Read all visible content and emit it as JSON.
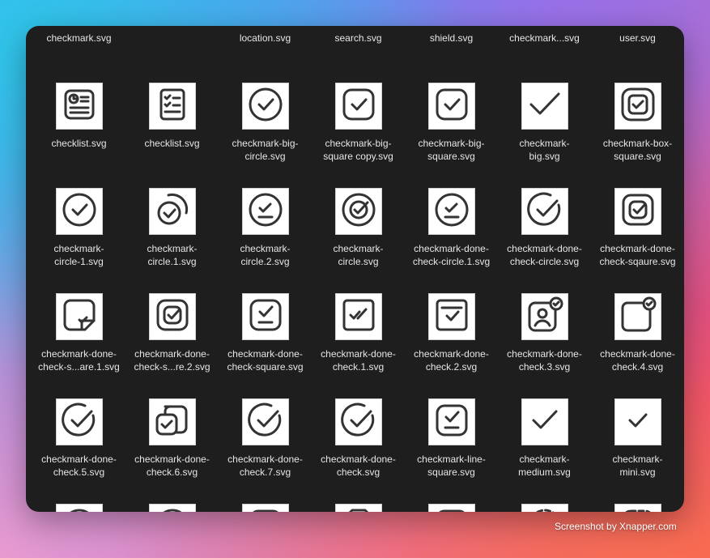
{
  "window": {
    "files": [
      {
        "name": "checkmark.svg",
        "icon": "checkmark-icon"
      },
      {
        "name": "",
        "icon": "blank"
      },
      {
        "name": "location.svg",
        "icon": "location-icon"
      },
      {
        "name": "search.svg",
        "icon": "search-icon"
      },
      {
        "name": "shield.svg",
        "icon": "shield-icon"
      },
      {
        "name": "checkmark...svg",
        "icon": "checkmark-icon"
      },
      {
        "name": "user.svg",
        "icon": "user-icon"
      },
      {
        "name": "checklist.svg",
        "icon": "checklist-clock-icon"
      },
      {
        "name": "checklist.svg",
        "icon": "checklist-document-icon"
      },
      {
        "name": "checkmark-big-\ncircle.svg",
        "icon": "checkmark-big-circle-icon"
      },
      {
        "name": "checkmark-big-\nsquare copy.svg",
        "icon": "checkmark-big-square-icon"
      },
      {
        "name": "checkmark-big-\nsquare.svg",
        "icon": "checkmark-big-square-icon"
      },
      {
        "name": "checkmark-\nbig.svg",
        "icon": "checkmark-big-icon"
      },
      {
        "name": "checkmark-box-\nsquare.svg",
        "icon": "checkmark-box-square-icon"
      },
      {
        "name": "checkmark-\ncircle-1.svg",
        "icon": "checkmark-circle-icon"
      },
      {
        "name": "checkmark-\ncircle.1.svg",
        "icon": "checkmark-circle-arc-icon"
      },
      {
        "name": "checkmark-\ncircle.2.svg",
        "icon": "checkmark-circle-line-icon"
      },
      {
        "name": "checkmark-\ncircle.svg",
        "icon": "checkmark-circle-nested-icon"
      },
      {
        "name": "checkmark-done-\ncheck-circle.1.svg",
        "icon": "checkmark-circle-line-icon"
      },
      {
        "name": "checkmark-done-\ncheck-circle.svg",
        "icon": "checkmark-circle-open-icon"
      },
      {
        "name": "checkmark-done-\ncheck-sqaure.svg",
        "icon": "checkmark-square-nested-icon"
      },
      {
        "name": "checkmark-done-\ncheck-s...are.1.svg",
        "icon": "checkmark-square-folded-icon"
      },
      {
        "name": "checkmark-done-\ncheck-s...re.2.svg",
        "icon": "checkmark-square-nested-icon"
      },
      {
        "name": "checkmark-done-\ncheck-square.svg",
        "icon": "checkmark-square-line-icon"
      },
      {
        "name": "checkmark-done-\ncheck.1.svg",
        "icon": "checkmark-double-square-icon"
      },
      {
        "name": "checkmark-done-\ncheck.2.svg",
        "icon": "checkmark-square-tab-icon"
      },
      {
        "name": "checkmark-done-\ncheck.3.svg",
        "icon": "user-check-badge-icon"
      },
      {
        "name": "checkmark-done-\ncheck.4.svg",
        "icon": "square-check-badge-icon"
      },
      {
        "name": "checkmark-done-\ncheck.5.svg",
        "icon": "checkmark-circle-open-icon"
      },
      {
        "name": "checkmark-done-\ncheck.6.svg",
        "icon": "checkmark-stacked-squares-icon"
      },
      {
        "name": "checkmark-done-\ncheck.7.svg",
        "icon": "checkmark-circle-open-icon"
      },
      {
        "name": "checkmark-done-\ncheck.svg",
        "icon": "checkmark-circle-open-icon"
      },
      {
        "name": "checkmark-line-\nsquare.svg",
        "icon": "checkmark-square-line-icon"
      },
      {
        "name": "checkmark-\nmedium.svg",
        "icon": "checkmark-medium-icon"
      },
      {
        "name": "checkmark-\nmini.svg",
        "icon": "checkmark-mini-icon"
      },
      {
        "name": "",
        "icon": "double-check-circle-icon"
      },
      {
        "name": "",
        "icon": "double-check-line-circle-icon"
      },
      {
        "name": "",
        "icon": "double-check-line-square-icon"
      },
      {
        "name": "",
        "icon": "double-check-octagon-icon"
      },
      {
        "name": "",
        "icon": "double-check-square-icon"
      },
      {
        "name": "",
        "icon": "double-check-dashed-circle-icon"
      },
      {
        "name": "",
        "icon": "double-check-dashed-square-icon"
      }
    ]
  },
  "footer": {
    "credit": "Screenshot by Xnapper.com"
  }
}
